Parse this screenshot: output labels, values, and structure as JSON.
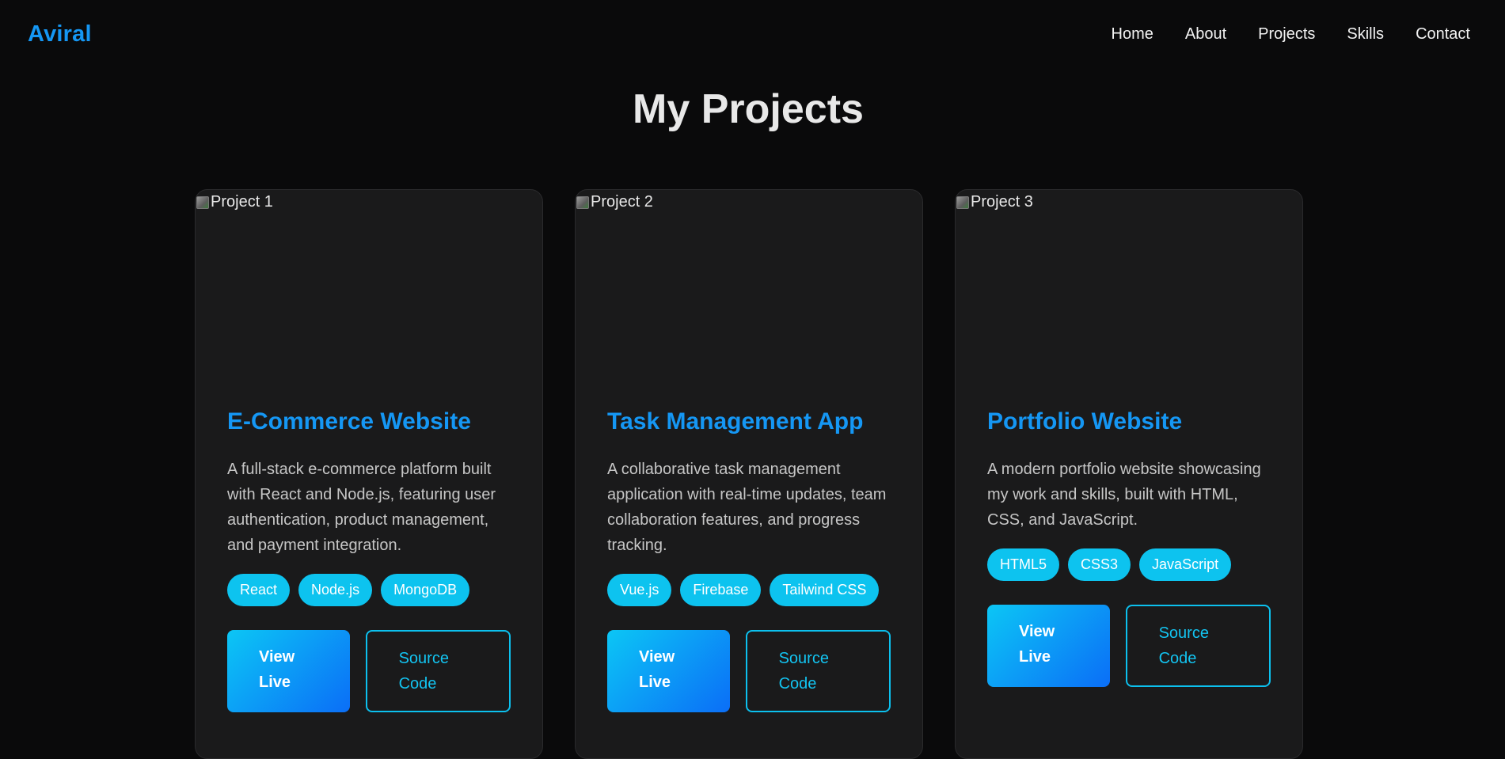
{
  "nav": {
    "logo": "Aviral",
    "links": [
      "Home",
      "About",
      "Projects",
      "Skills",
      "Contact"
    ]
  },
  "section": {
    "title": "My Projects"
  },
  "projects": [
    {
      "image_alt": "Project 1",
      "title": "E-Commerce Website",
      "description": "A full-stack e-commerce platform built with React and Node.js, featuring user authentication, product management, and payment integration.",
      "tags": [
        "React",
        "Node.js",
        "MongoDB"
      ],
      "live_label": "View Live",
      "source_label": "Source Code"
    },
    {
      "image_alt": "Project 2",
      "title": "Task Management App",
      "description": "A collaborative task management application with real-time updates, team collaboration features, and progress tracking.",
      "tags": [
        "Vue.js",
        "Firebase",
        "Tailwind CSS"
      ],
      "live_label": "View Live",
      "source_label": "Source Code"
    },
    {
      "image_alt": "Project 3",
      "title": "Portfolio Website",
      "description": "A modern portfolio website showcasing my work and skills, built with HTML, CSS, and JavaScript.",
      "tags": [
        "HTML5",
        "CSS3",
        "JavaScript"
      ],
      "live_label": "View Live",
      "source_label": "Source Code"
    }
  ],
  "colors": {
    "background": "#0a0a0b",
    "card": "#1a1a1b",
    "accent": "#1597f4",
    "tag": "#0dc3ef",
    "button_gradient_start": "#0cc6f5",
    "button_gradient_end": "#0b6ef7"
  },
  "icons": {
    "broken_image": "broken-image-icon"
  }
}
